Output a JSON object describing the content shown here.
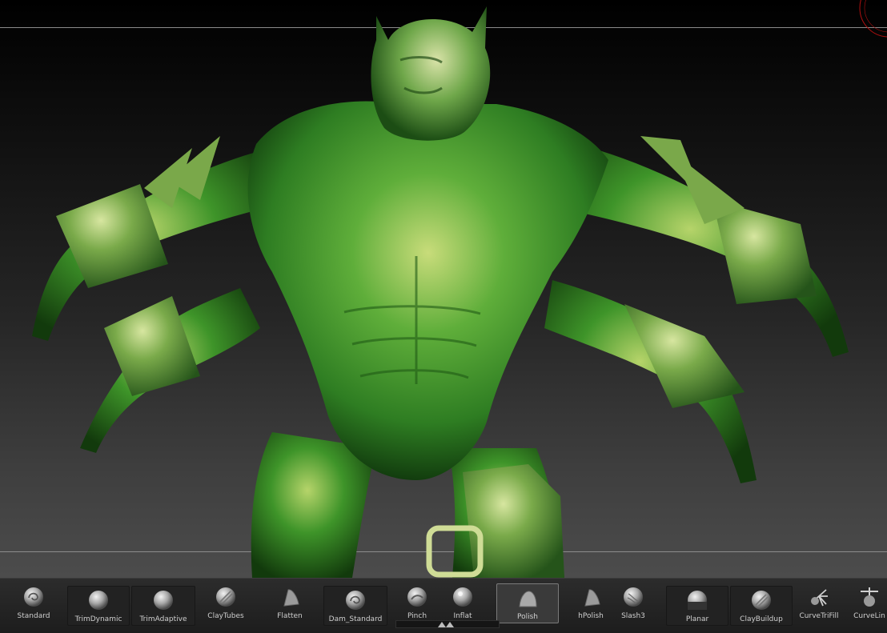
{
  "brush_shelf": {
    "selected": "Polish",
    "brushes": [
      {
        "label": "Standard",
        "icon": "standard-brush-icon"
      },
      {
        "label": "TrimDynamic",
        "icon": "trimdynamic-brush-icon"
      },
      {
        "label": "TrimAdaptive",
        "icon": "trimadaptive-brush-icon"
      },
      {
        "label": "ClayTubes",
        "icon": "claytubes-brush-icon"
      },
      {
        "label": "Flatten",
        "icon": "flatten-brush-icon"
      },
      {
        "label": "Dam_Standard",
        "icon": "dam-standard-brush-icon"
      },
      {
        "label": "Pinch",
        "icon": "pinch-brush-icon"
      },
      {
        "label": "Inflat",
        "icon": "inflat-brush-icon"
      },
      {
        "label": "Polish",
        "icon": "polish-brush-icon"
      },
      {
        "label": "hPolish",
        "icon": "hpolish-brush-icon"
      },
      {
        "label": "Slash3",
        "icon": "slash3-brush-icon"
      },
      {
        "label": "Planar",
        "icon": "planar-brush-icon"
      },
      {
        "label": "ClayBuildup",
        "icon": "claybuildup-brush-icon"
      },
      {
        "label": "CurveTriFill",
        "icon": "curvetrifill-brush-icon"
      },
      {
        "label": "CurveLin",
        "icon": "curvelin-brush-icon"
      }
    ]
  },
  "colors": {
    "model_green": "#3f9a2c",
    "model_highlight": "#d8e8a0",
    "viewport_top": "#000000",
    "viewport_bottom": "#4c4c4c",
    "shelf_bg": "#242424",
    "corner_arc": "#b01010"
  }
}
